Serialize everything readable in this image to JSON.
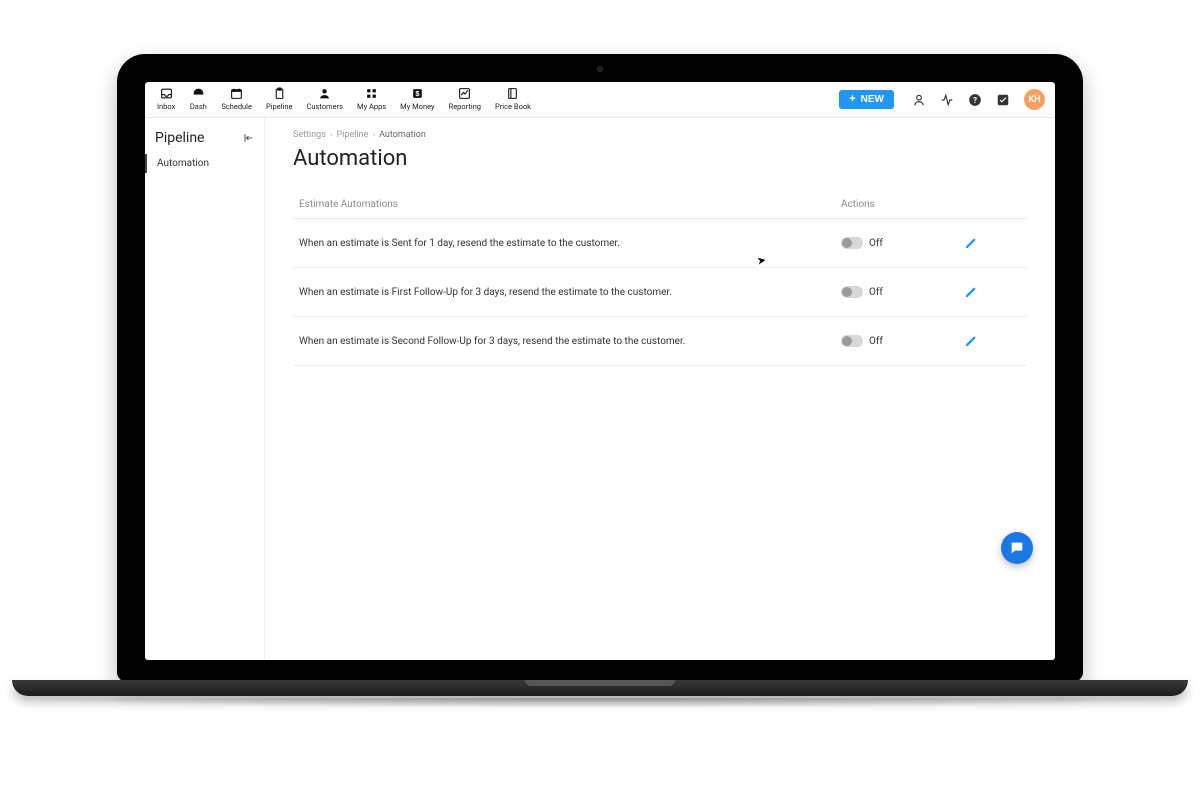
{
  "nav": [
    {
      "id": "inbox",
      "label": "Inbox"
    },
    {
      "id": "dash",
      "label": "Dash"
    },
    {
      "id": "schedule",
      "label": "Schedule"
    },
    {
      "id": "pipeline",
      "label": "Pipeline"
    },
    {
      "id": "customers",
      "label": "Customers"
    },
    {
      "id": "myapps",
      "label": "My Apps"
    },
    {
      "id": "mymoney",
      "label": "My Money"
    },
    {
      "id": "reporting",
      "label": "Reporting"
    },
    {
      "id": "pricebook",
      "label": "Price Book"
    }
  ],
  "new_button": {
    "label": "NEW"
  },
  "avatar": {
    "initials": "KH"
  },
  "sidebar": {
    "title": "Pipeline",
    "items": [
      {
        "id": "automation",
        "label": "Automation",
        "active": true
      }
    ]
  },
  "breadcrumb": {
    "items": [
      {
        "label": "Settings"
      },
      {
        "label": "Pipeline"
      },
      {
        "label": "Automation",
        "current": true
      }
    ]
  },
  "page": {
    "title": "Automation"
  },
  "table": {
    "headers": {
      "col1": "Estimate Automations",
      "col2": "Actions"
    },
    "rows": [
      {
        "description": "When an estimate is Sent for 1 day, resend the estimate to the customer.",
        "state_label": "Off"
      },
      {
        "description": "When an estimate is First Follow-Up for 3 days, resend the estimate to the customer.",
        "state_label": "Off"
      },
      {
        "description": "When an estimate is Second Follow-Up for 3 days, resend the estimate to the customer.",
        "state_label": "Off"
      }
    ]
  }
}
